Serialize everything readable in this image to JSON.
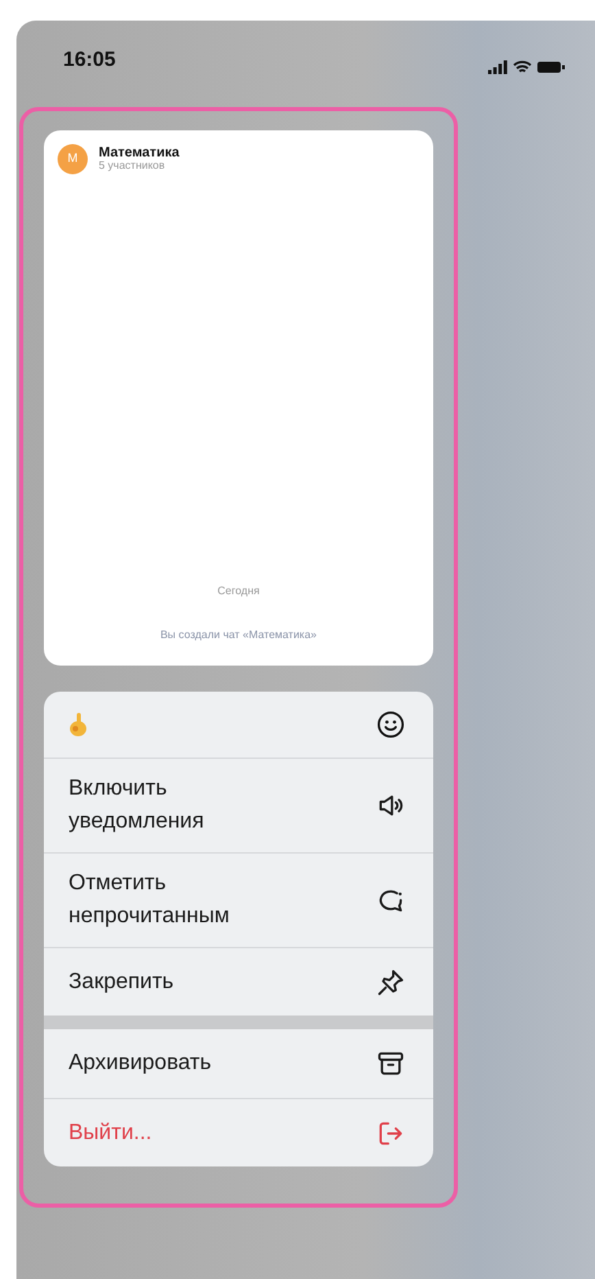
{
  "status_bar": {
    "time": "16:05"
  },
  "chat_preview": {
    "avatar_letter": "М",
    "title": "Математика",
    "subtitle": "5 участников",
    "date": "Сегодня",
    "system_message": "Вы создали чат «Математика»"
  },
  "menu": {
    "groups": [
      [
        {
          "kind": "reactions"
        },
        {
          "kind": "action",
          "label": "Включить уведомления",
          "destructive": false
        },
        {
          "kind": "action",
          "label": "Отметить непрочитанным",
          "destructive": false
        },
        {
          "kind": "action",
          "label": "Закрепить",
          "destructive": false
        }
      ],
      [
        {
          "kind": "action",
          "label": "Архивировать",
          "destructive": false
        },
        {
          "kind": "action",
          "label": "Выйти...",
          "destructive": true
        }
      ]
    ]
  }
}
